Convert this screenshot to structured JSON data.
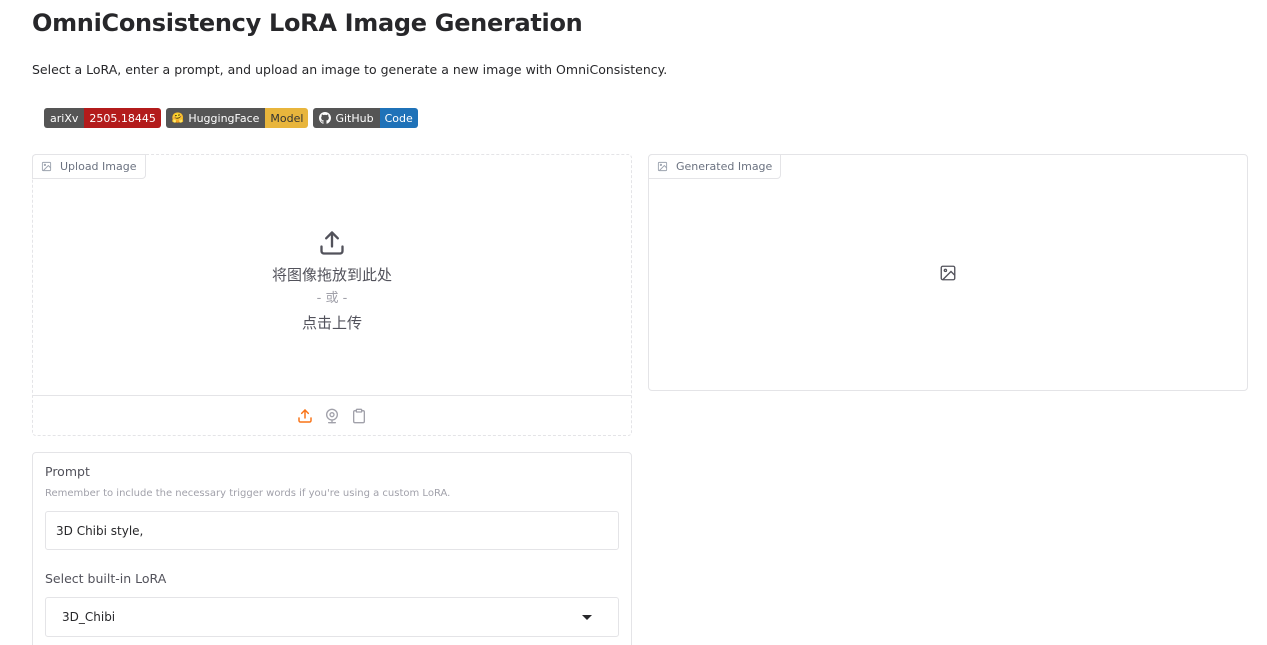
{
  "header": {
    "title": "OmniConsistency LoRA Image Generation",
    "description": "Select a LoRA, enter a prompt, and upload an image to generate a new image with OmniConsistency."
  },
  "badges": [
    {
      "left": "ariXv",
      "right": "2505.18445",
      "color": "#b31b1b"
    },
    {
      "left": "HuggingFace",
      "right": "Model",
      "color": "#e8b53c",
      "icon": "huggingface-icon"
    },
    {
      "left": "GitHub",
      "right": "Code",
      "color": "#1f72b8",
      "icon": "github-icon"
    }
  ],
  "upload": {
    "label": "Upload Image",
    "drop_text": "将图像拖放到此处",
    "or_text": "- 或 -",
    "click_text": "点击上传",
    "sources": [
      "upload-icon",
      "webcam-icon",
      "clipboard-icon"
    ],
    "accent": "#f97316"
  },
  "generated": {
    "label": "Generated Image"
  },
  "prompt": {
    "label": "Prompt",
    "info": "Remember to include the necessary trigger words if you're using a custom LoRA.",
    "value": "3D Chibi style,"
  },
  "lora_select": {
    "label": "Select built-in LoRA",
    "value": "3D_Chibi"
  }
}
